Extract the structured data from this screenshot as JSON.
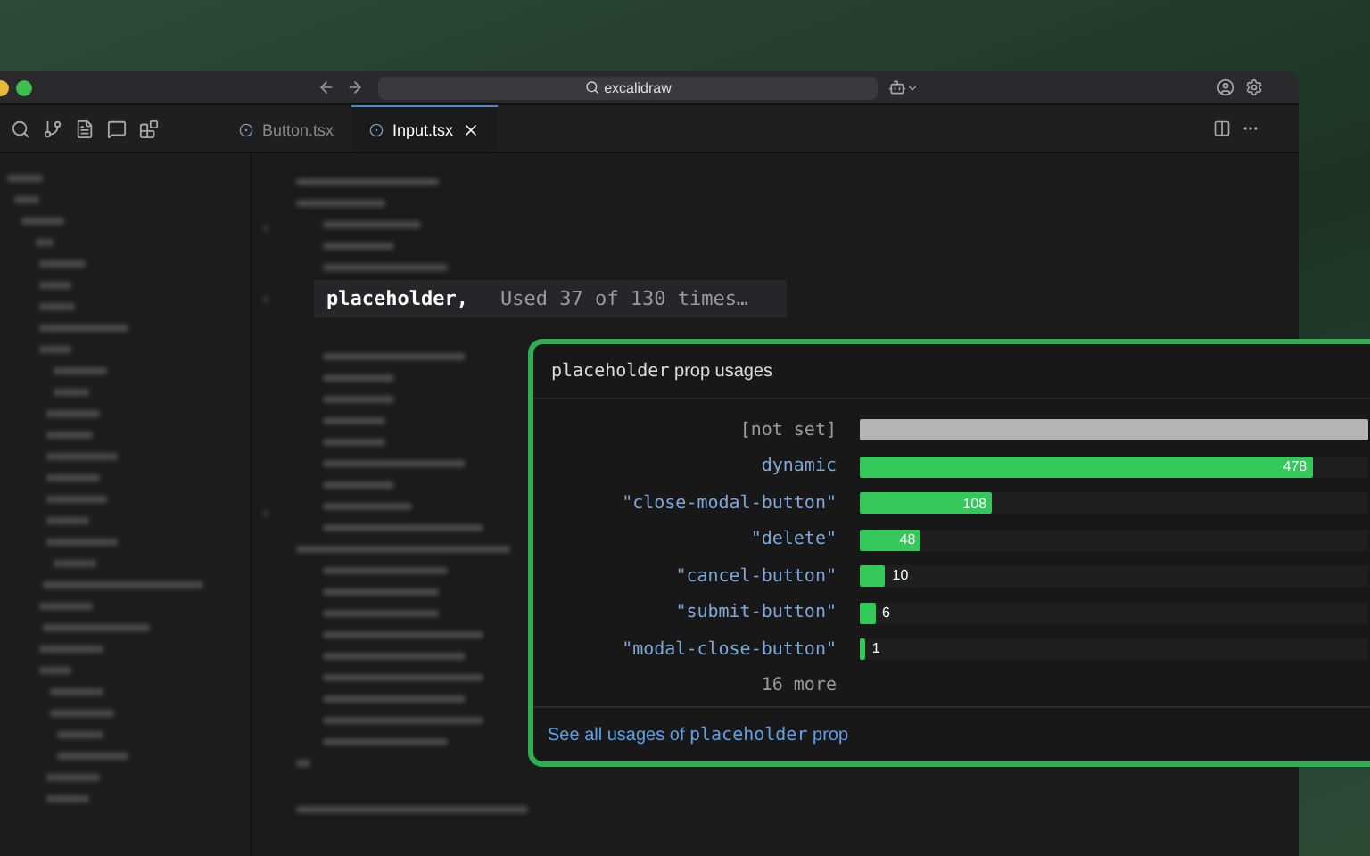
{
  "window": {
    "search": "excalidraw"
  },
  "tabs": [
    {
      "label": "Button.tsx",
      "selected": false
    },
    {
      "label": "Input.tsx",
      "selected": true
    }
  ],
  "hover": {
    "code": "placeholder,",
    "hint": "Used 37 of 130 times…"
  },
  "popup": {
    "title": {
      "prop": "placeholder",
      "text": "prop usages"
    },
    "rows": [
      {
        "label": "[not set]",
        "kind": "unset",
        "level": 1,
        "color": "#b4b4b4"
      },
      {
        "label": "dynamic",
        "kind": "value",
        "level": 0.89,
        "value": "478",
        "color": "#34c759"
      },
      {
        "label": "\"close-modal-button\"",
        "kind": "value",
        "level": 0.26,
        "value": "108",
        "color": "#34c759"
      },
      {
        "label": "\"delete\"",
        "kind": "value",
        "level": 0.12,
        "value": "48",
        "color": "#34c759"
      },
      {
        "label": "\"cancel-button\"",
        "kind": "value",
        "level": 0.05,
        "value": "10",
        "color": "#34c759"
      },
      {
        "label": "\"submit-button\"",
        "kind": "value",
        "level": 0.03,
        "value": "6",
        "color": "#34c759"
      },
      {
        "label": "\"modal-close-button\"",
        "kind": "value",
        "level": 0.01,
        "value": "1",
        "color": "#34c759"
      }
    ],
    "more": "16 more",
    "link": {
      "text": "See all usages of",
      "prop": "placeholder",
      "suffix": "prop"
    }
  }
}
